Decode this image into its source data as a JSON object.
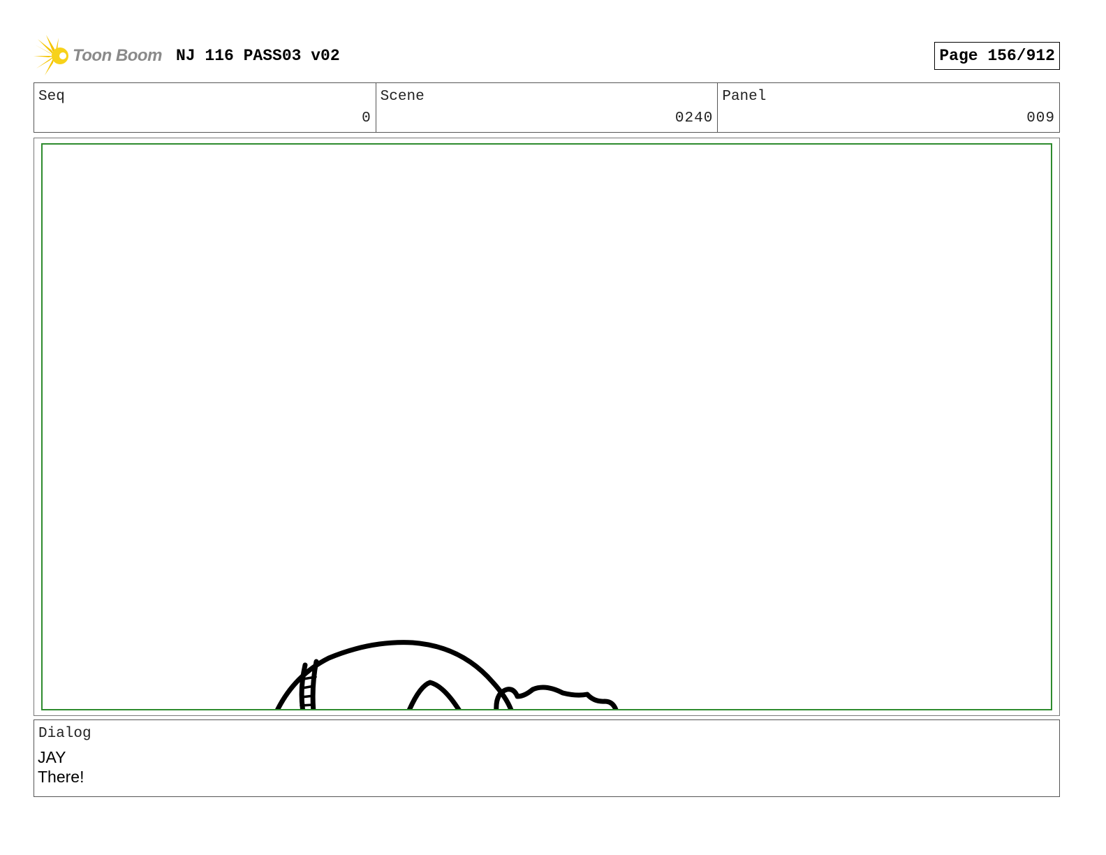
{
  "header": {
    "logo_text": "Toon Boom",
    "project_title": "NJ 116 PASS03 v02",
    "page_label": "Page 156/912"
  },
  "info": {
    "seq": {
      "label": "Seq",
      "value": "0"
    },
    "scene": {
      "label": "Scene",
      "value": "0240"
    },
    "panel": {
      "label": "Panel",
      "value": "009"
    }
  },
  "dialog": {
    "label": "Dialog",
    "speaker": "JAY",
    "line": "There!"
  },
  "colors": {
    "safe_frame": "#2e8b2e",
    "logo_star": "#f5c400"
  }
}
